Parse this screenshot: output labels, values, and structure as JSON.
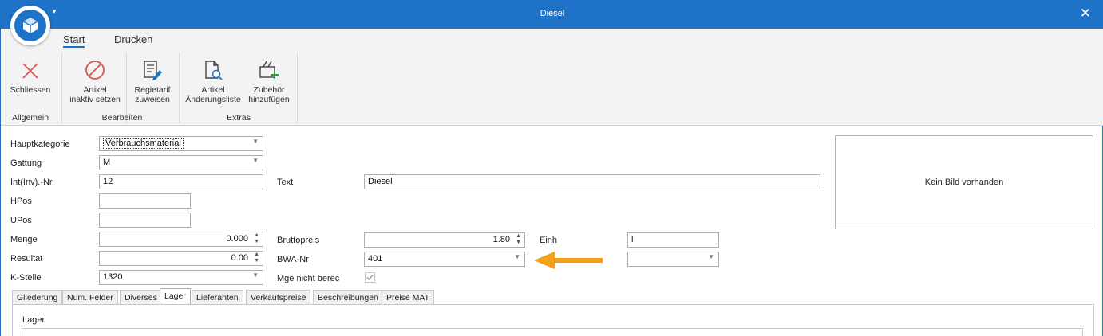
{
  "window": {
    "title": "Diesel",
    "close_glyph": "✕",
    "quick_access_glyph": "▼"
  },
  "tabs": [
    {
      "label": "Start",
      "active": true
    },
    {
      "label": "Drucken",
      "active": false
    }
  ],
  "ribbon": {
    "buttons": {
      "close": {
        "label": "Schliessen",
        "icon": "close-x-icon"
      },
      "inactive": {
        "label1": "Artikel",
        "label2": "inaktiv setzen",
        "icon": "no-entry-icon"
      },
      "regtarif": {
        "label1": "Regietarif",
        "label2": "zuweisen",
        "icon": "edit-list-icon"
      },
      "changes": {
        "label1": "Artikel",
        "label2": "Änderungsliste",
        "icon": "document-search-icon"
      },
      "accessory": {
        "label1": "Zubehör",
        "label2": "hinzufügen",
        "icon": "tools-add-icon"
      }
    },
    "groups": {
      "general": "Allgemein",
      "edit": "Bearbeiten",
      "extras": "Extras"
    }
  },
  "form": {
    "hauptkategorie": {
      "label": "Hauptkategorie",
      "value": "Verbrauchsmaterial"
    },
    "gattung": {
      "label": "Gattung",
      "value": "M"
    },
    "intnr": {
      "label": "Int(Inv).-Nr.",
      "value": "12"
    },
    "hpos": {
      "label": "HPos",
      "value": ""
    },
    "upos": {
      "label": "UPos",
      "value": ""
    },
    "menge": {
      "label": "Menge",
      "value": "0.000"
    },
    "resultat": {
      "label": "Resultat",
      "value": "0.00"
    },
    "kstelle": {
      "label": "K-Stelle",
      "value": "1320"
    },
    "text": {
      "label": "Text",
      "value": "Diesel"
    },
    "bruttopreis": {
      "label": "Bruttopreis",
      "value": "1.80"
    },
    "bwanr": {
      "label": "BWA-Nr",
      "value": "401"
    },
    "mge": {
      "label": "Mge nicht berec",
      "checked": true
    },
    "einh": {
      "label": "Einh",
      "value": "l"
    },
    "einh2": {
      "value": ""
    },
    "image_placeholder": "Kein Bild vorhanden"
  },
  "page_tabs": [
    {
      "label": "Gliederung",
      "active": false
    },
    {
      "label": "Num. Felder",
      "active": false
    },
    {
      "label": "Diverses",
      "active": false
    },
    {
      "label": "Lager",
      "active": true
    },
    {
      "label": "Lieferanten",
      "active": false
    },
    {
      "label": "Verkaufspreise",
      "active": false
    },
    {
      "label": "Beschreibungen",
      "active": false
    },
    {
      "label": "Preise MAT",
      "active": false
    }
  ],
  "lager": {
    "title": "Lager"
  },
  "colors": {
    "accent": "#1e73c8",
    "arrow": "#f5a01a",
    "close_icon": "#d9534f"
  }
}
